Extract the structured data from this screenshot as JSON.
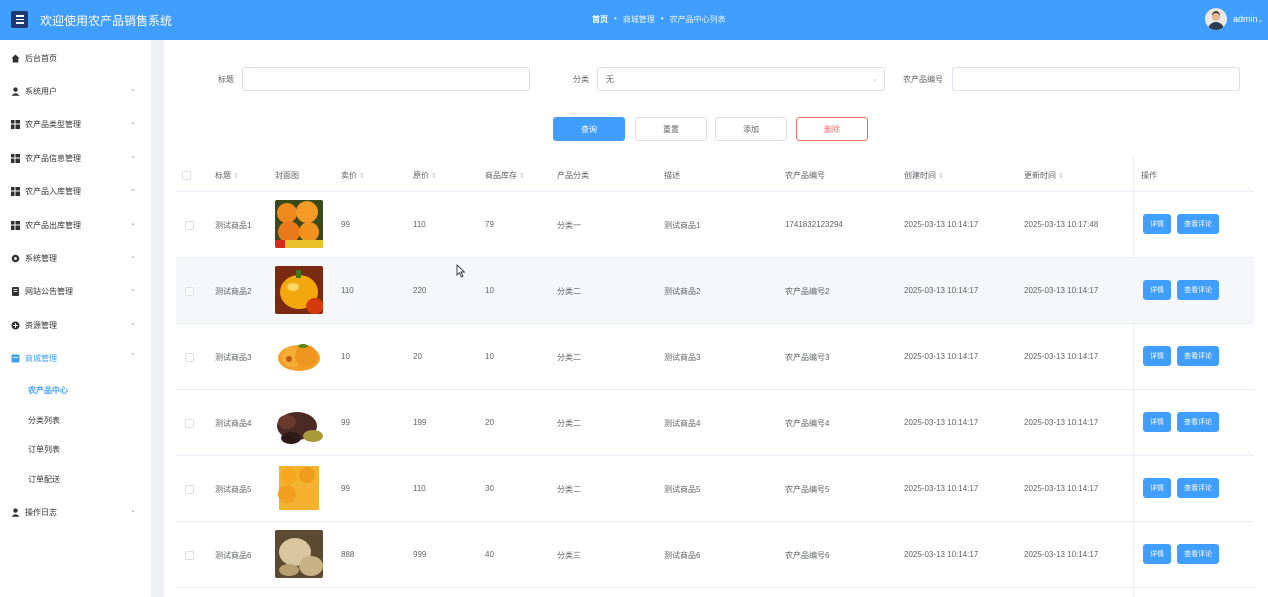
{
  "header": {
    "app_title": "欢迎使用农产品销售系统",
    "breadcrumb": [
      "首页",
      "商城管理",
      "农产品中心列表"
    ],
    "user_name": "admin",
    "accent": "#409eff"
  },
  "sidebar": {
    "items": [
      {
        "label": "后台首页",
        "icon": "home-icon"
      },
      {
        "label": "系统用户",
        "icon": "user-icon"
      },
      {
        "label": "农产品类型管理",
        "icon": "grid-icon"
      },
      {
        "label": "农产品信息管理",
        "icon": "grid-icon"
      },
      {
        "label": "农产品入库管理",
        "icon": "grid-icon"
      },
      {
        "label": "农产品出库管理",
        "icon": "grid-icon"
      },
      {
        "label": "系统管理",
        "icon": "gear-icon"
      },
      {
        "label": "网站公告管理",
        "icon": "notice-icon"
      },
      {
        "label": "资源管理",
        "icon": "resource-icon"
      },
      {
        "label": "商城管理",
        "icon": "shop-icon"
      },
      {
        "label": "操作日志",
        "icon": "user-icon"
      }
    ],
    "shop_sub": [
      "农产品中心",
      "分类列表",
      "订单列表",
      "订单配送"
    ]
  },
  "filters": {
    "title_label": "标题",
    "title_value": "",
    "category_label": "分类",
    "category_value": "无",
    "code_label": "农产品编号",
    "code_value": ""
  },
  "buttons": {
    "search": "查询",
    "reset": "重置",
    "add": "添加",
    "delete": "删除"
  },
  "table": {
    "headers": [
      "标题",
      "封面图",
      "卖价",
      "原价",
      "商品库存",
      "产品分类",
      "描述",
      "农产品编号",
      "创建时间",
      "更新时间",
      "操作"
    ],
    "detail_label": "详情",
    "review_label": "查看评论",
    "rows": [
      {
        "title": "测试商品1",
        "price": "99",
        "original": "110",
        "stock": "79",
        "category": "分类一",
        "desc": "测试商品1",
        "code": "1741832123294",
        "created": "2025-03-13 10:14:17",
        "updated": "2025-03-13 10:17:48"
      },
      {
        "title": "测试商品2",
        "price": "110",
        "original": "220",
        "stock": "10",
        "category": "分类二",
        "desc": "测试商品2",
        "code": "农产品编号2",
        "created": "2025-03-13 10:14:17",
        "updated": "2025-03-13 10:14:17"
      },
      {
        "title": "测试商品3",
        "price": "10",
        "original": "20",
        "stock": "10",
        "category": "分类二",
        "desc": "测试商品3",
        "code": "农产品编号3",
        "created": "2025-03-13 10:14:17",
        "updated": "2025-03-13 10:14:17"
      },
      {
        "title": "测试商品4",
        "price": "99",
        "original": "199",
        "stock": "20",
        "category": "分类二",
        "desc": "测试商品4",
        "code": "农产品编号4",
        "created": "2025-03-13 10:14:17",
        "updated": "2025-03-13 10:14:17"
      },
      {
        "title": "测试商品5",
        "price": "99",
        "original": "110",
        "stock": "30",
        "category": "分类二",
        "desc": "测试商品5",
        "code": "农产品编号5",
        "created": "2025-03-13 10:14:17",
        "updated": "2025-03-13 10:14:17"
      },
      {
        "title": "测试商品6",
        "price": "888",
        "original": "999",
        "stock": "40",
        "category": "分类三",
        "desc": "测试商品6",
        "code": "农产品编号6",
        "created": "2025-03-13 10:14:17",
        "updated": "2025-03-13 10:14:17"
      }
    ]
  }
}
